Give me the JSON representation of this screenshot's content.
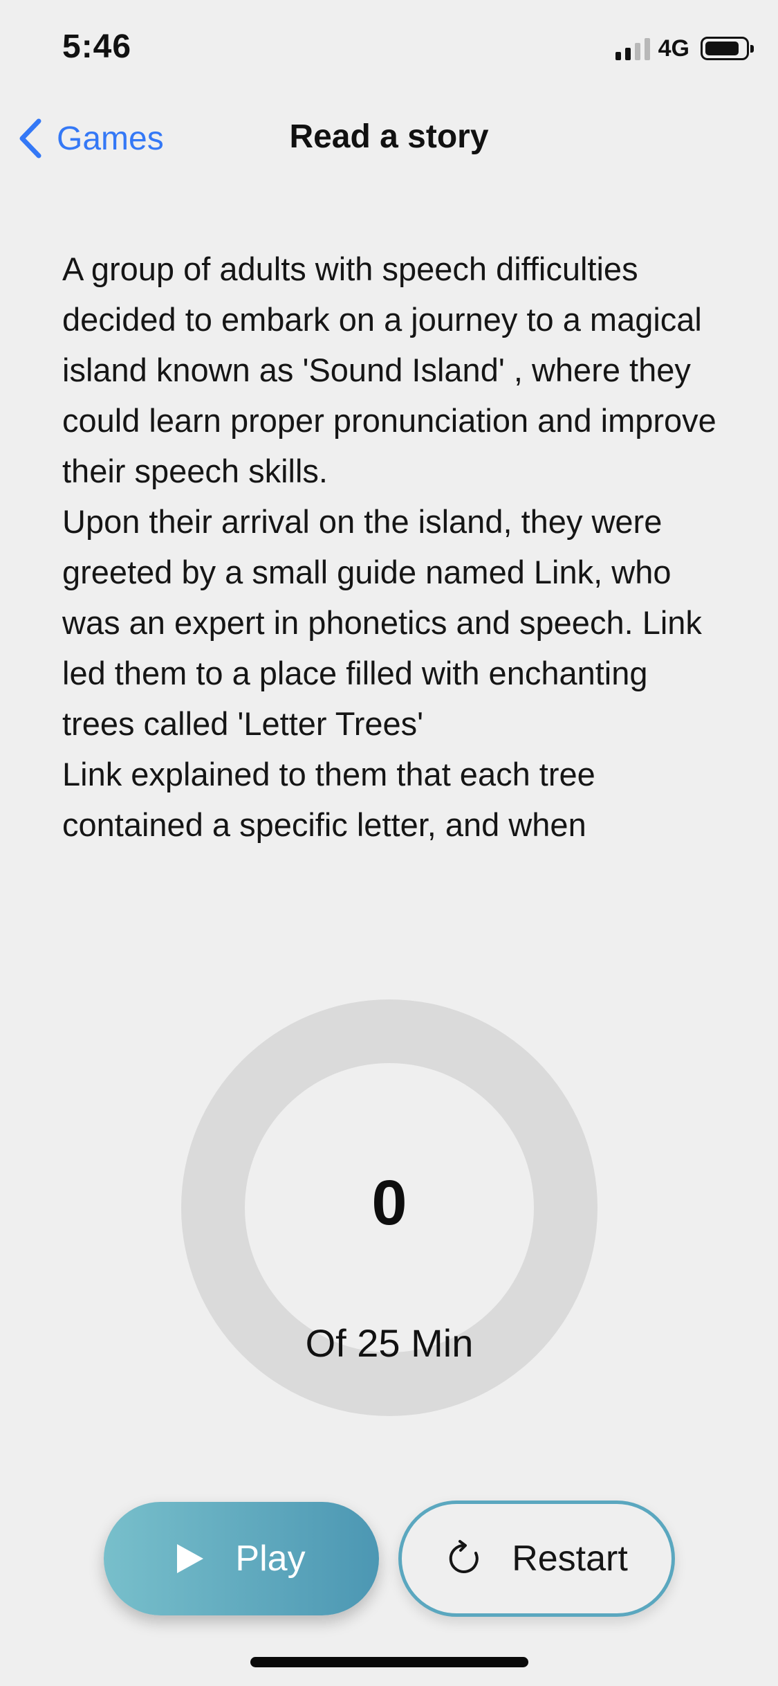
{
  "status_bar": {
    "time": "5:46",
    "network": "4G",
    "signal_icon": "cellular-signal-icon",
    "battery_icon": "battery-icon",
    "battery_level": 0.85
  },
  "nav": {
    "back_label": "Games",
    "back_icon": "chevron-left-icon",
    "title": "Read a story",
    "accent_color": "#3478f6"
  },
  "story": {
    "paragraphs": [
      "A group of adults with speech difficulties decided to embark on a journey to a magical island known as 'Sound Island' , where they could learn proper pronunciation and improve their speech skills.",
      "Upon their arrival on the island, they were greeted by a small guide named Link, who was an expert in phonetics and speech. Link led them to a place filled with enchanting trees called 'Letter Trees'",
      "Link explained to them that each tree contained a specific letter, and when"
    ]
  },
  "timer": {
    "value": "0",
    "caption": "Of 25 Min",
    "progress": 0
  },
  "controls": {
    "play_label": "Play",
    "play_icon": "play-icon",
    "restart_label": "Restart",
    "restart_icon": "restart-icon",
    "play_gradient": [
      "#78bfcb",
      "#4c97b3"
    ],
    "restart_border_color": "#5aa7bf"
  }
}
